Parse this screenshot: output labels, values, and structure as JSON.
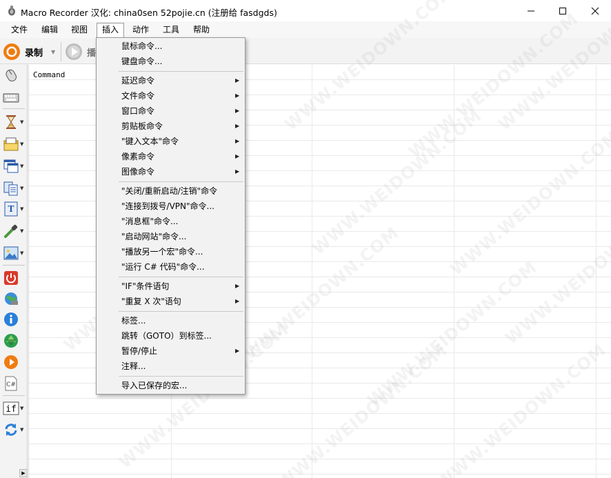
{
  "window": {
    "title": "Macro Recorder 汉化: china0sen 52pojie.cn (注册给 fasdgds)"
  },
  "menubar": {
    "items": [
      {
        "label": "文件"
      },
      {
        "label": "编辑"
      },
      {
        "label": "视图"
      },
      {
        "label": "插入"
      },
      {
        "label": "动作"
      },
      {
        "label": "工具"
      },
      {
        "label": "帮助"
      }
    ]
  },
  "toolbar": {
    "record_label": "录制",
    "play_label": "播"
  },
  "grid": {
    "header": "Command"
  },
  "watermark": "WWW.WEIDOWN.COM",
  "sidebar": {
    "icons": [
      "mouse-icon",
      "keyboard-icon",
      "hourglass-icon",
      "file-icon",
      "window-icon",
      "clipboard-icon",
      "type-text-icon",
      "eyedropper-icon",
      "image-icon",
      "shutdown-icon",
      "globe-icon",
      "info-icon",
      "website-icon",
      "play-macro-icon",
      "csharp-icon",
      "if-icon",
      "repeat-icon"
    ],
    "csharp_label": "C#",
    "if_label": "if"
  },
  "insert_menu": {
    "items": [
      {
        "label": "鼠标命令..."
      },
      {
        "label": "键盘命令..."
      },
      {
        "label": "延迟命令"
      },
      {
        "label": "文件命令"
      },
      {
        "label": "窗口命令"
      },
      {
        "label": "剪贴板命令"
      },
      {
        "label": "\"键入文本\"命令"
      },
      {
        "label": "像素命令"
      },
      {
        "label": "图像命令"
      },
      {
        "label": "\"关闭/重新启动/注销\"命令"
      },
      {
        "label": "\"连接到拨号/VPN\"命令..."
      },
      {
        "label": "\"消息框\"命令..."
      },
      {
        "label": "\"启动网站\"命令..."
      },
      {
        "label": "\"播放另一个宏\"命令..."
      },
      {
        "label": "\"运行 C# 代码\"命令..."
      },
      {
        "label": "\"IF\"条件语句"
      },
      {
        "label": "\"重复 X 次\"语句"
      },
      {
        "label": "标签..."
      },
      {
        "label": "跳转（GOTO）到标签..."
      },
      {
        "label": "暂停/停止"
      },
      {
        "label": "注释..."
      },
      {
        "label": "导入已保存的宏..."
      }
    ]
  }
}
